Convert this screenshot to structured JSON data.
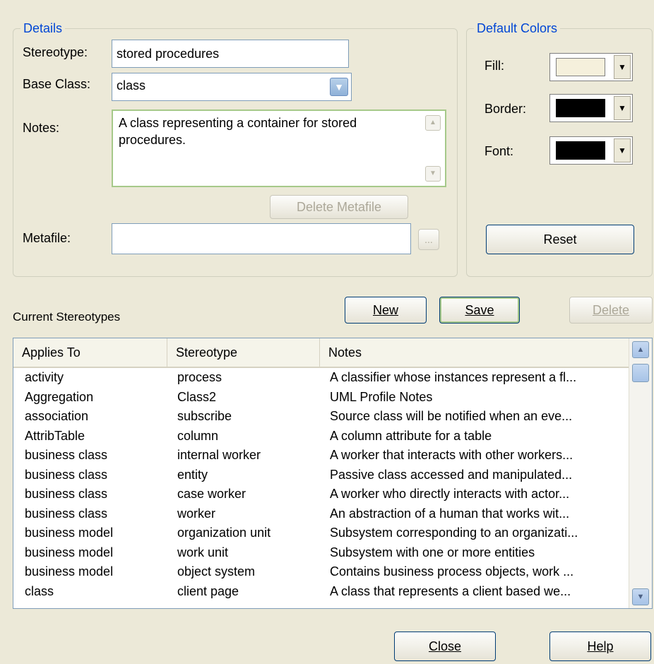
{
  "details": {
    "legend": "Details",
    "stereotype_label": "Stereotype:",
    "stereotype_value": "stored procedures",
    "base_class_label": "Base Class:",
    "base_class_value": "class",
    "notes_label": "Notes:",
    "notes_value": "A class representing a container for stored procedures.",
    "delete_metafile_label": "Delete Metafile",
    "metafile_label": "Metafile:",
    "metafile_value": "",
    "browse_label": "..."
  },
  "default_colors": {
    "legend": "Default Colors",
    "fill_label": "Fill:",
    "fill_color": "#f5f0dc",
    "border_label": "Border:",
    "border_color": "#000000",
    "font_label": "Font:",
    "font_color": "#000000",
    "reset_label": "Reset"
  },
  "current": {
    "label": "Current Stereotypes",
    "new_label": "New",
    "save_label": "Save",
    "delete_label": "Delete"
  },
  "table": {
    "columns": [
      "Applies To",
      "Stereotype",
      "Notes"
    ],
    "rows": [
      [
        "activity",
        "process",
        "A classifier whose instances represent a fl..."
      ],
      [
        "Aggregation",
        "Class2",
        "UML Profile Notes"
      ],
      [
        "association",
        "subscribe",
        "Source class will be notified when an eve..."
      ],
      [
        "AttribTable",
        "column",
        "A column attribute for a table"
      ],
      [
        "business class",
        "internal worker",
        "A worker that interacts with other workers..."
      ],
      [
        "business class",
        "entity",
        "Passive class accessed and manipulated..."
      ],
      [
        "business class",
        "case worker",
        "A worker who directly interacts with actor..."
      ],
      [
        "business class",
        "worker",
        "An abstraction of a human that works wit..."
      ],
      [
        "business model",
        "organization unit",
        "Subsystem corresponding to an organizati..."
      ],
      [
        "business model",
        "work unit",
        "Subsystem with one or more entities"
      ],
      [
        "business model",
        "object system",
        "Contains business process objects, work ..."
      ],
      [
        "class",
        "client page",
        "A class that represents a client based we..."
      ]
    ]
  },
  "footer": {
    "close_label": "Close",
    "help_label": "Help"
  }
}
